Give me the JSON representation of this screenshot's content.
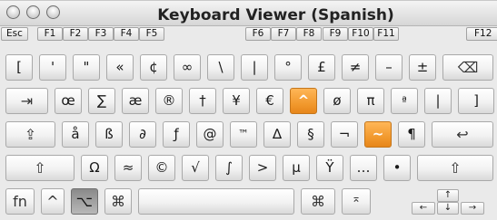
{
  "window": {
    "title": "Keyboard Viewer (Spanish)"
  },
  "function_row": [
    "Esc",
    "F1",
    "F2",
    "F3",
    "F4",
    "F5",
    "F6",
    "F7",
    "F8",
    "F9",
    "F10",
    "F11",
    "F12"
  ],
  "rows": [
    [
      "[",
      "'",
      "\"",
      "«",
      "¢",
      "∞",
      "\\",
      "|",
      "°",
      "£",
      "≠",
      "–",
      "±",
      "⌫"
    ],
    [
      "⇥",
      "œ",
      "∑",
      "æ",
      "®",
      "†",
      "¥",
      "€",
      "^",
      "ø",
      "π",
      "ª",
      "|",
      "]"
    ],
    [
      "⇪",
      "å",
      "ß",
      "∂",
      "ƒ",
      "@",
      "™",
      "∆",
      "§",
      "¬",
      "~",
      "¶",
      "↩"
    ],
    [
      "⇧",
      "Ω",
      "≈",
      "©",
      "√",
      "∫",
      ">",
      "µ",
      "Ÿ",
      "…",
      "•",
      "⇧"
    ],
    [
      "fn",
      "^",
      "⌥",
      "⌘",
      "",
      "⌘",
      "⌅"
    ]
  ],
  "arrows": {
    "up": "↑",
    "left": "←",
    "down": "↓",
    "right": "→"
  },
  "colors": {
    "dead_key": "#f29a2f",
    "key_face": "#f2f2f2"
  }
}
